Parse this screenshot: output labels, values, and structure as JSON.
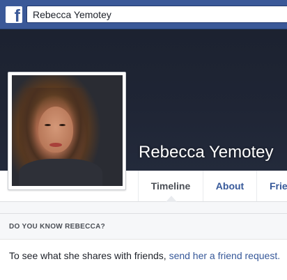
{
  "header": {
    "logo_letter": "f",
    "search_value": "Rebecca Yemotey",
    "brand_color": "#3b5998"
  },
  "profile": {
    "name": "Rebecca Yemotey"
  },
  "nav": {
    "tabs": [
      {
        "label": "Timeline",
        "active": true
      },
      {
        "label": "About",
        "active": false
      },
      {
        "label": "Frie",
        "active": false
      }
    ]
  },
  "know_card": {
    "title": "DO YOU KNOW REBECCA?",
    "text_prefix": "To see what she shares with friends, ",
    "link_text": "send her a friend request."
  },
  "icons": {
    "logo": "facebook-icon"
  }
}
